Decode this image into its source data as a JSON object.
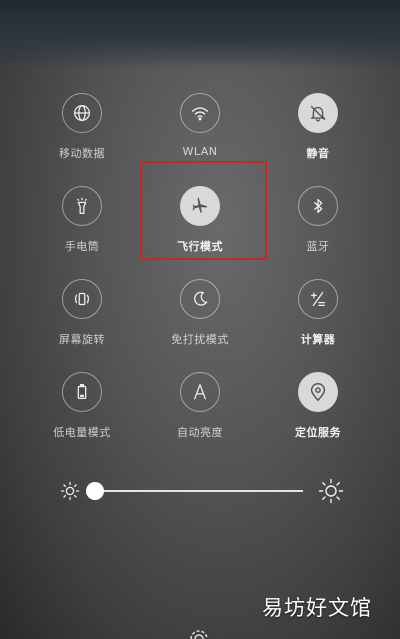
{
  "tiles": [
    {
      "label": "移动数据",
      "icon": "globe-icon",
      "active": false
    },
    {
      "label": "WLAN",
      "icon": "wifi-icon",
      "active": false
    },
    {
      "label": "静音",
      "icon": "bell-mute-icon",
      "active": true
    },
    {
      "label": "手电筒",
      "icon": "flashlight-icon",
      "active": false
    },
    {
      "label": "飞行模式",
      "icon": "airplane-icon",
      "active": true
    },
    {
      "label": "蓝牙",
      "icon": "bluetooth-icon",
      "active": false
    },
    {
      "label": "屏幕旋转",
      "icon": "rotate-icon",
      "active": false
    },
    {
      "label": "免打扰模式",
      "icon": "moon-icon",
      "active": false
    },
    {
      "label": "计算器",
      "icon": "calculator-icon",
      "active": false
    },
    {
      "label": "低电量模式",
      "icon": "battery-icon",
      "active": false
    },
    {
      "label": "自动亮度",
      "icon": "auto-brightness-icon",
      "active": false
    },
    {
      "label": "定位服务",
      "icon": "location-icon",
      "active": true
    }
  ],
  "brightness": {
    "level": 0.0,
    "min_icon": "sun-small-icon",
    "max_icon": "sun-large-icon"
  },
  "highlight_color": "#c62828",
  "watermark": "易坊好文馆",
  "bottom_icon": "settings-gear-icon"
}
